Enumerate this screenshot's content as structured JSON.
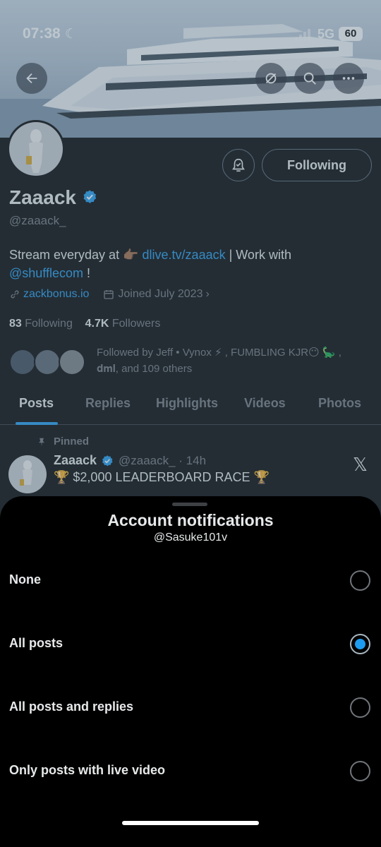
{
  "status_bar": {
    "time": "07:38",
    "network": "5G",
    "battery": "60"
  },
  "profile": {
    "display_name": "Zaaack",
    "handle": "@zaaack_",
    "bio_prefix": "Stream everyday at",
    "bio_emoji": "👉🏾",
    "bio_link": "dlive.tv/zaaack",
    "bio_middle": " | Work with",
    "bio_mention": "@shufflecom",
    "bio_suffix": " !",
    "website": "zackbonus.io",
    "joined": "Joined July 2023",
    "following_count": "83",
    "following_label": "Following",
    "followers_count": "4.7K",
    "followers_label": "Followers",
    "followed_by_line1": "Followed by Jeff • Vynox ⚡ , FUMBLING KJR😶 🦕 ,",
    "followed_by_line2": "𝐝𝐦𝐥, and 109 others",
    "following_button": "Following"
  },
  "tabs": [
    {
      "label": "Posts",
      "active": true
    },
    {
      "label": "Replies",
      "active": false
    },
    {
      "label": "Highlights",
      "active": false
    },
    {
      "label": "Videos",
      "active": false
    },
    {
      "label": "Photos",
      "active": false
    }
  ],
  "pinned_post": {
    "pinned_label": "Pinned",
    "author": "Zaaack",
    "handle_time": "@zaaack_ · 14h",
    "text": "🏆 $2,000 LEADERBOARD RACE 🏆"
  },
  "sheet": {
    "title": "Account notifications",
    "subtitle": "@Sasuke101v",
    "options": [
      {
        "label": "None",
        "checked": false
      },
      {
        "label": "All posts",
        "checked": true
      },
      {
        "label": "All posts and replies",
        "checked": false
      },
      {
        "label": "Only posts with live video",
        "checked": false
      }
    ]
  },
  "colors": {
    "accent": "#1d9bf0",
    "background": "#000000",
    "text": "#e7e9ea",
    "muted": "#71767b"
  }
}
